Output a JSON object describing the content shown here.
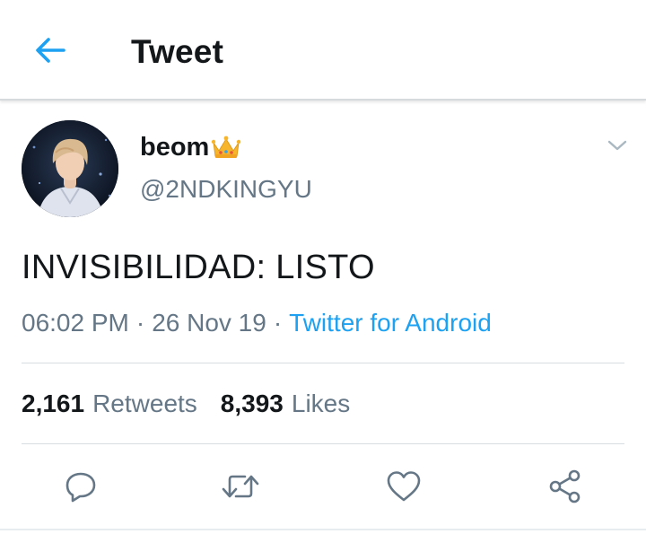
{
  "colors": {
    "accent": "#1da1f2",
    "text_primary": "#14171a",
    "text_secondary": "#657786",
    "divider": "#d8dde1",
    "crown": "#f7b52c"
  },
  "header": {
    "back_icon": "arrow-left-icon",
    "title": "Tweet"
  },
  "author": {
    "display_name": "beom",
    "name_emoji": "crown-icon",
    "handle": "@2NDKINGYU",
    "menu_icon": "chevron-down-icon"
  },
  "tweet": {
    "text": "INVISIBILIDAD: LISTO",
    "time": "06:02 PM",
    "separator": "·",
    "date": "26 Nov 19",
    "source": "Twitter for Android"
  },
  "stats": {
    "retweets_count": "2,161",
    "retweets_label": "Retweets",
    "likes_count": "8,393",
    "likes_label": "Likes"
  },
  "actions": [
    {
      "icon": "reply-icon"
    },
    {
      "icon": "retweet-icon"
    },
    {
      "icon": "heart-icon"
    },
    {
      "icon": "share-icon"
    }
  ]
}
